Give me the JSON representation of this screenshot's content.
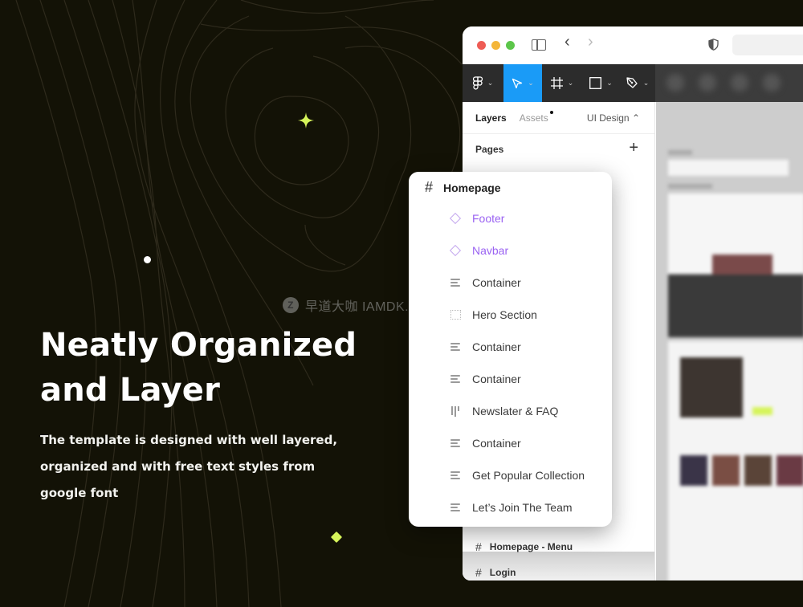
{
  "hero": {
    "title_line1": "Neatly Organized",
    "title_line2": "and Layer",
    "description_line1": "The template is designed with well layered,",
    "description_line2": "organized and with free text styles from",
    "description_line3": "google font"
  },
  "colors": {
    "background": "#131206",
    "accent_lime": "#d6f45a",
    "tool_active": "#1a9bf7",
    "component_purple": "#9a62f2"
  },
  "browser": {
    "nav_back": "‹",
    "nav_forward": "›"
  },
  "toolbar": {
    "tools": [
      {
        "name": "figma-menu",
        "icon": "figma-icon"
      },
      {
        "name": "move",
        "icon": "cursor-icon",
        "active": true
      },
      {
        "name": "frame",
        "icon": "frame-icon"
      },
      {
        "name": "shape",
        "icon": "rectangle-icon"
      },
      {
        "name": "pen",
        "icon": "pen-icon"
      }
    ],
    "chevron": "⌄"
  },
  "panel": {
    "tab_layers": "Layers",
    "tab_assets": "Assets",
    "page_select": "UI Design ⌃",
    "pages_label": "Pages",
    "add_page": "+",
    "pages": [
      {
        "label": "Homepage - Menu"
      },
      {
        "label": "Login"
      }
    ]
  },
  "popup": {
    "frame_title": "Homepage",
    "hash": "#",
    "layers": [
      {
        "label": "Footer",
        "type": "component"
      },
      {
        "label": "Navbar",
        "type": "component"
      },
      {
        "label": "Container",
        "type": "auto-layout"
      },
      {
        "label": "Hero Section",
        "type": "frame"
      },
      {
        "label": "Container",
        "type": "auto-layout"
      },
      {
        "label": "Container",
        "type": "auto-layout"
      },
      {
        "label": "Newslater & FAQ",
        "type": "horizontal-layout"
      },
      {
        "label": "Container",
        "type": "auto-layout"
      },
      {
        "label": "Get Popular Collection",
        "type": "auto-layout"
      },
      {
        "label": "Let’s Join The Team",
        "type": "auto-layout"
      }
    ]
  },
  "watermark": {
    "logo": "Z",
    "text": "早道大咖  IAMDK.TAOBAO.COM"
  }
}
